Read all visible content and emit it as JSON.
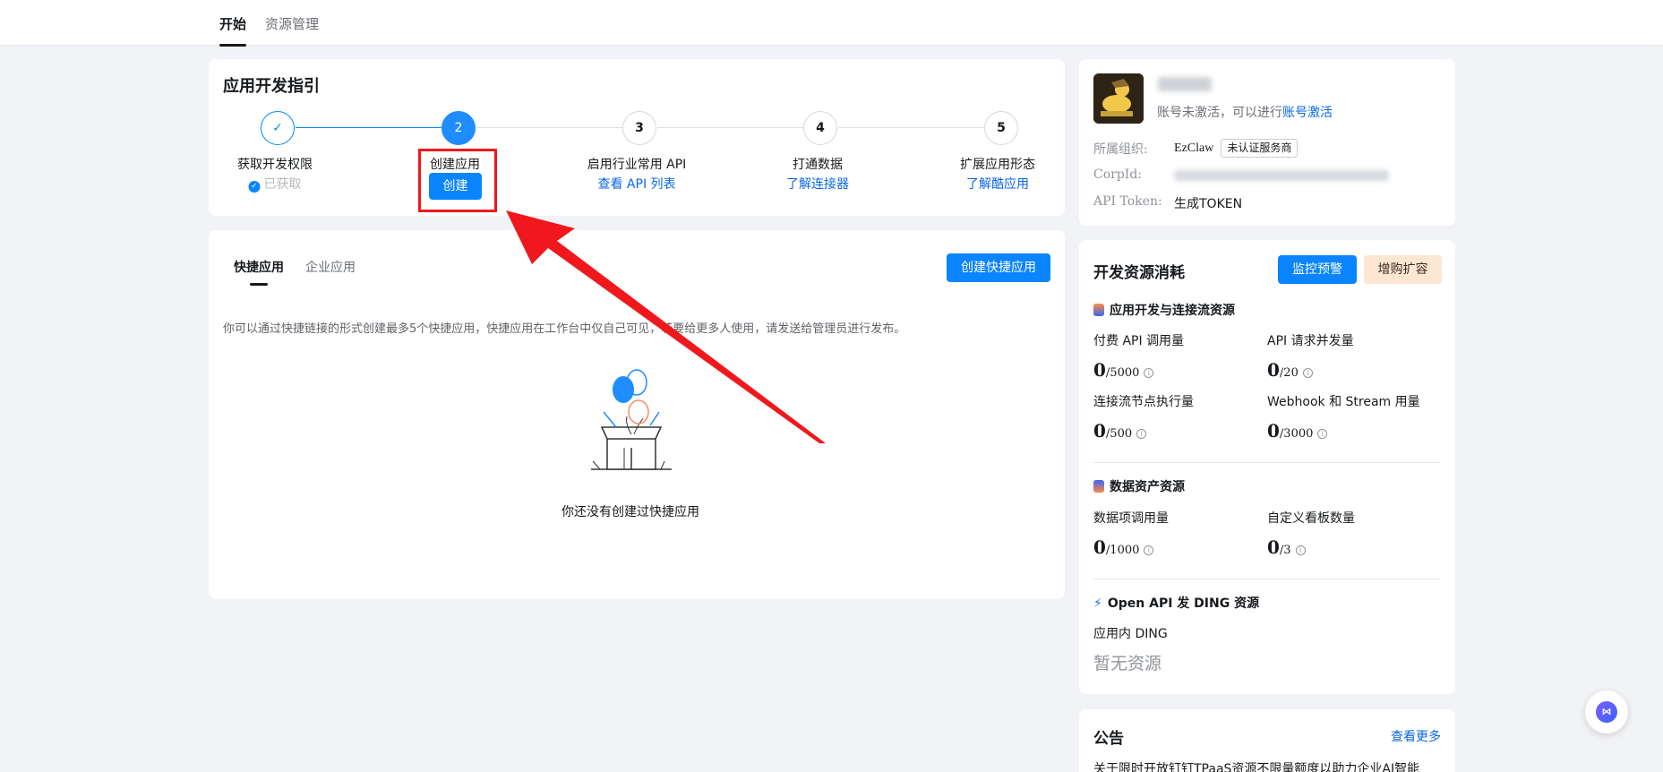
{
  "top_tabs": [
    {
      "label": "开始",
      "active": true
    },
    {
      "label": "资源管理",
      "active": false
    }
  ],
  "guide": {
    "title": "应用开发指引",
    "steps": [
      {
        "number": "",
        "label": "获取开发权限",
        "sub": "已获取",
        "status": "done"
      },
      {
        "number": "2",
        "label": "创建应用",
        "sub": "",
        "button": "创建",
        "status": "active"
      },
      {
        "number": "3",
        "label": "启用行业常用 API",
        "sub": "查看 API 列表",
        "status": "pending"
      },
      {
        "number": "4",
        "label": "打通数据",
        "sub": "了解连接器",
        "status": "pending"
      },
      {
        "number": "5",
        "label": "扩展应用形态",
        "sub": "了解酷应用",
        "status": "pending"
      }
    ]
  },
  "quick_apps": {
    "tabs": [
      {
        "label": "快捷应用",
        "active": true
      },
      {
        "label": "企业应用",
        "active": false
      }
    ],
    "create_button": "创建快捷应用",
    "description": "你可以通过快捷链接的形式创建最多5个快捷应用，快捷应用在工作台中仅自己可见，若要给更多人使用，请发送给管理员进行发布。",
    "empty_text": "你还没有创建过快捷应用"
  },
  "profile": {
    "account_status": "账号未激活，可以进行",
    "activate_link": "账号激活",
    "org_label": "所属组织:",
    "org_value": "EzClaw",
    "org_badge": "未认证服务商",
    "corpid_label": "CorpId:",
    "token_label": "API Token:",
    "token_link": "生成TOKEN"
  },
  "resources": {
    "title": "开发资源消耗",
    "monitor_button": "监控预警",
    "expand_button": "增购扩容",
    "sections": [
      {
        "title": "应用开发与连接流资源",
        "metrics": [
          {
            "label": "付费 API 调用量",
            "used": "0",
            "total": "/5000"
          },
          {
            "label": "API 请求并发量",
            "used": "0",
            "total": "/20"
          },
          {
            "label": "连接流节点执行量",
            "used": "0",
            "total": "/500"
          },
          {
            "label": "Webhook 和 Stream 用量",
            "used": "0",
            "total": "/3000"
          }
        ]
      },
      {
        "title": "数据资产资源",
        "metrics": [
          {
            "label": "数据项调用量",
            "used": "0",
            "total": "/1000"
          },
          {
            "label": "自定义看板数量",
            "used": "0",
            "total": "/3"
          }
        ]
      },
      {
        "title": "Open API 发 DING 资源",
        "sub_label": "应用内 DING",
        "empty": "暂无资源"
      }
    ],
    "colors": {
      "primary": "#0a84ff",
      "orange_bg": "#fde6d2"
    }
  },
  "notice": {
    "title": "公告",
    "more": "查看更多",
    "first_line": "关于限时开放钉钉TPaaS资源不限量额度以助力企业AI智能"
  },
  "icons": {
    "check": "✓",
    "info": "i",
    "float": "⋈"
  }
}
